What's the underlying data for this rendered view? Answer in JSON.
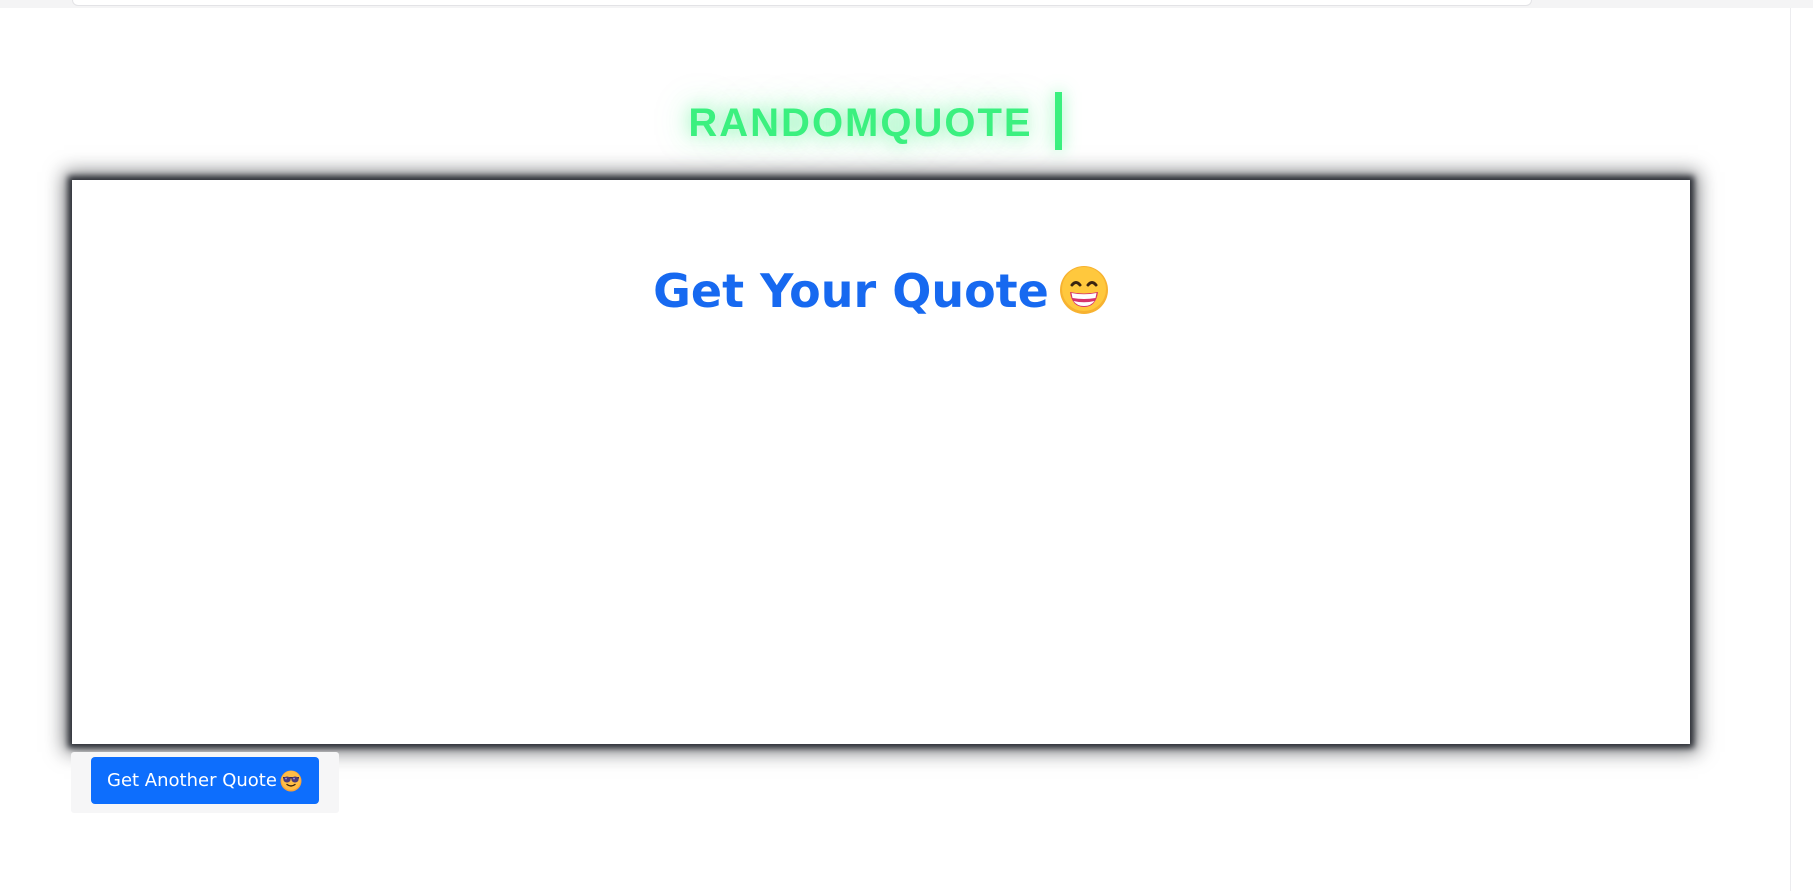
{
  "header": {
    "brand_text": "RANDOMQUOTE",
    "brand_color": "#3bf07f"
  },
  "card": {
    "title": "Get Your Quote",
    "title_emoji": "grinning-face-icon",
    "title_color": "#1769f0",
    "quote_text": ""
  },
  "actions": {
    "another_label": "Get Another Quote",
    "another_emoji": "smiling-face-with-sunglasses-icon",
    "button_color": "#0d6efd"
  }
}
